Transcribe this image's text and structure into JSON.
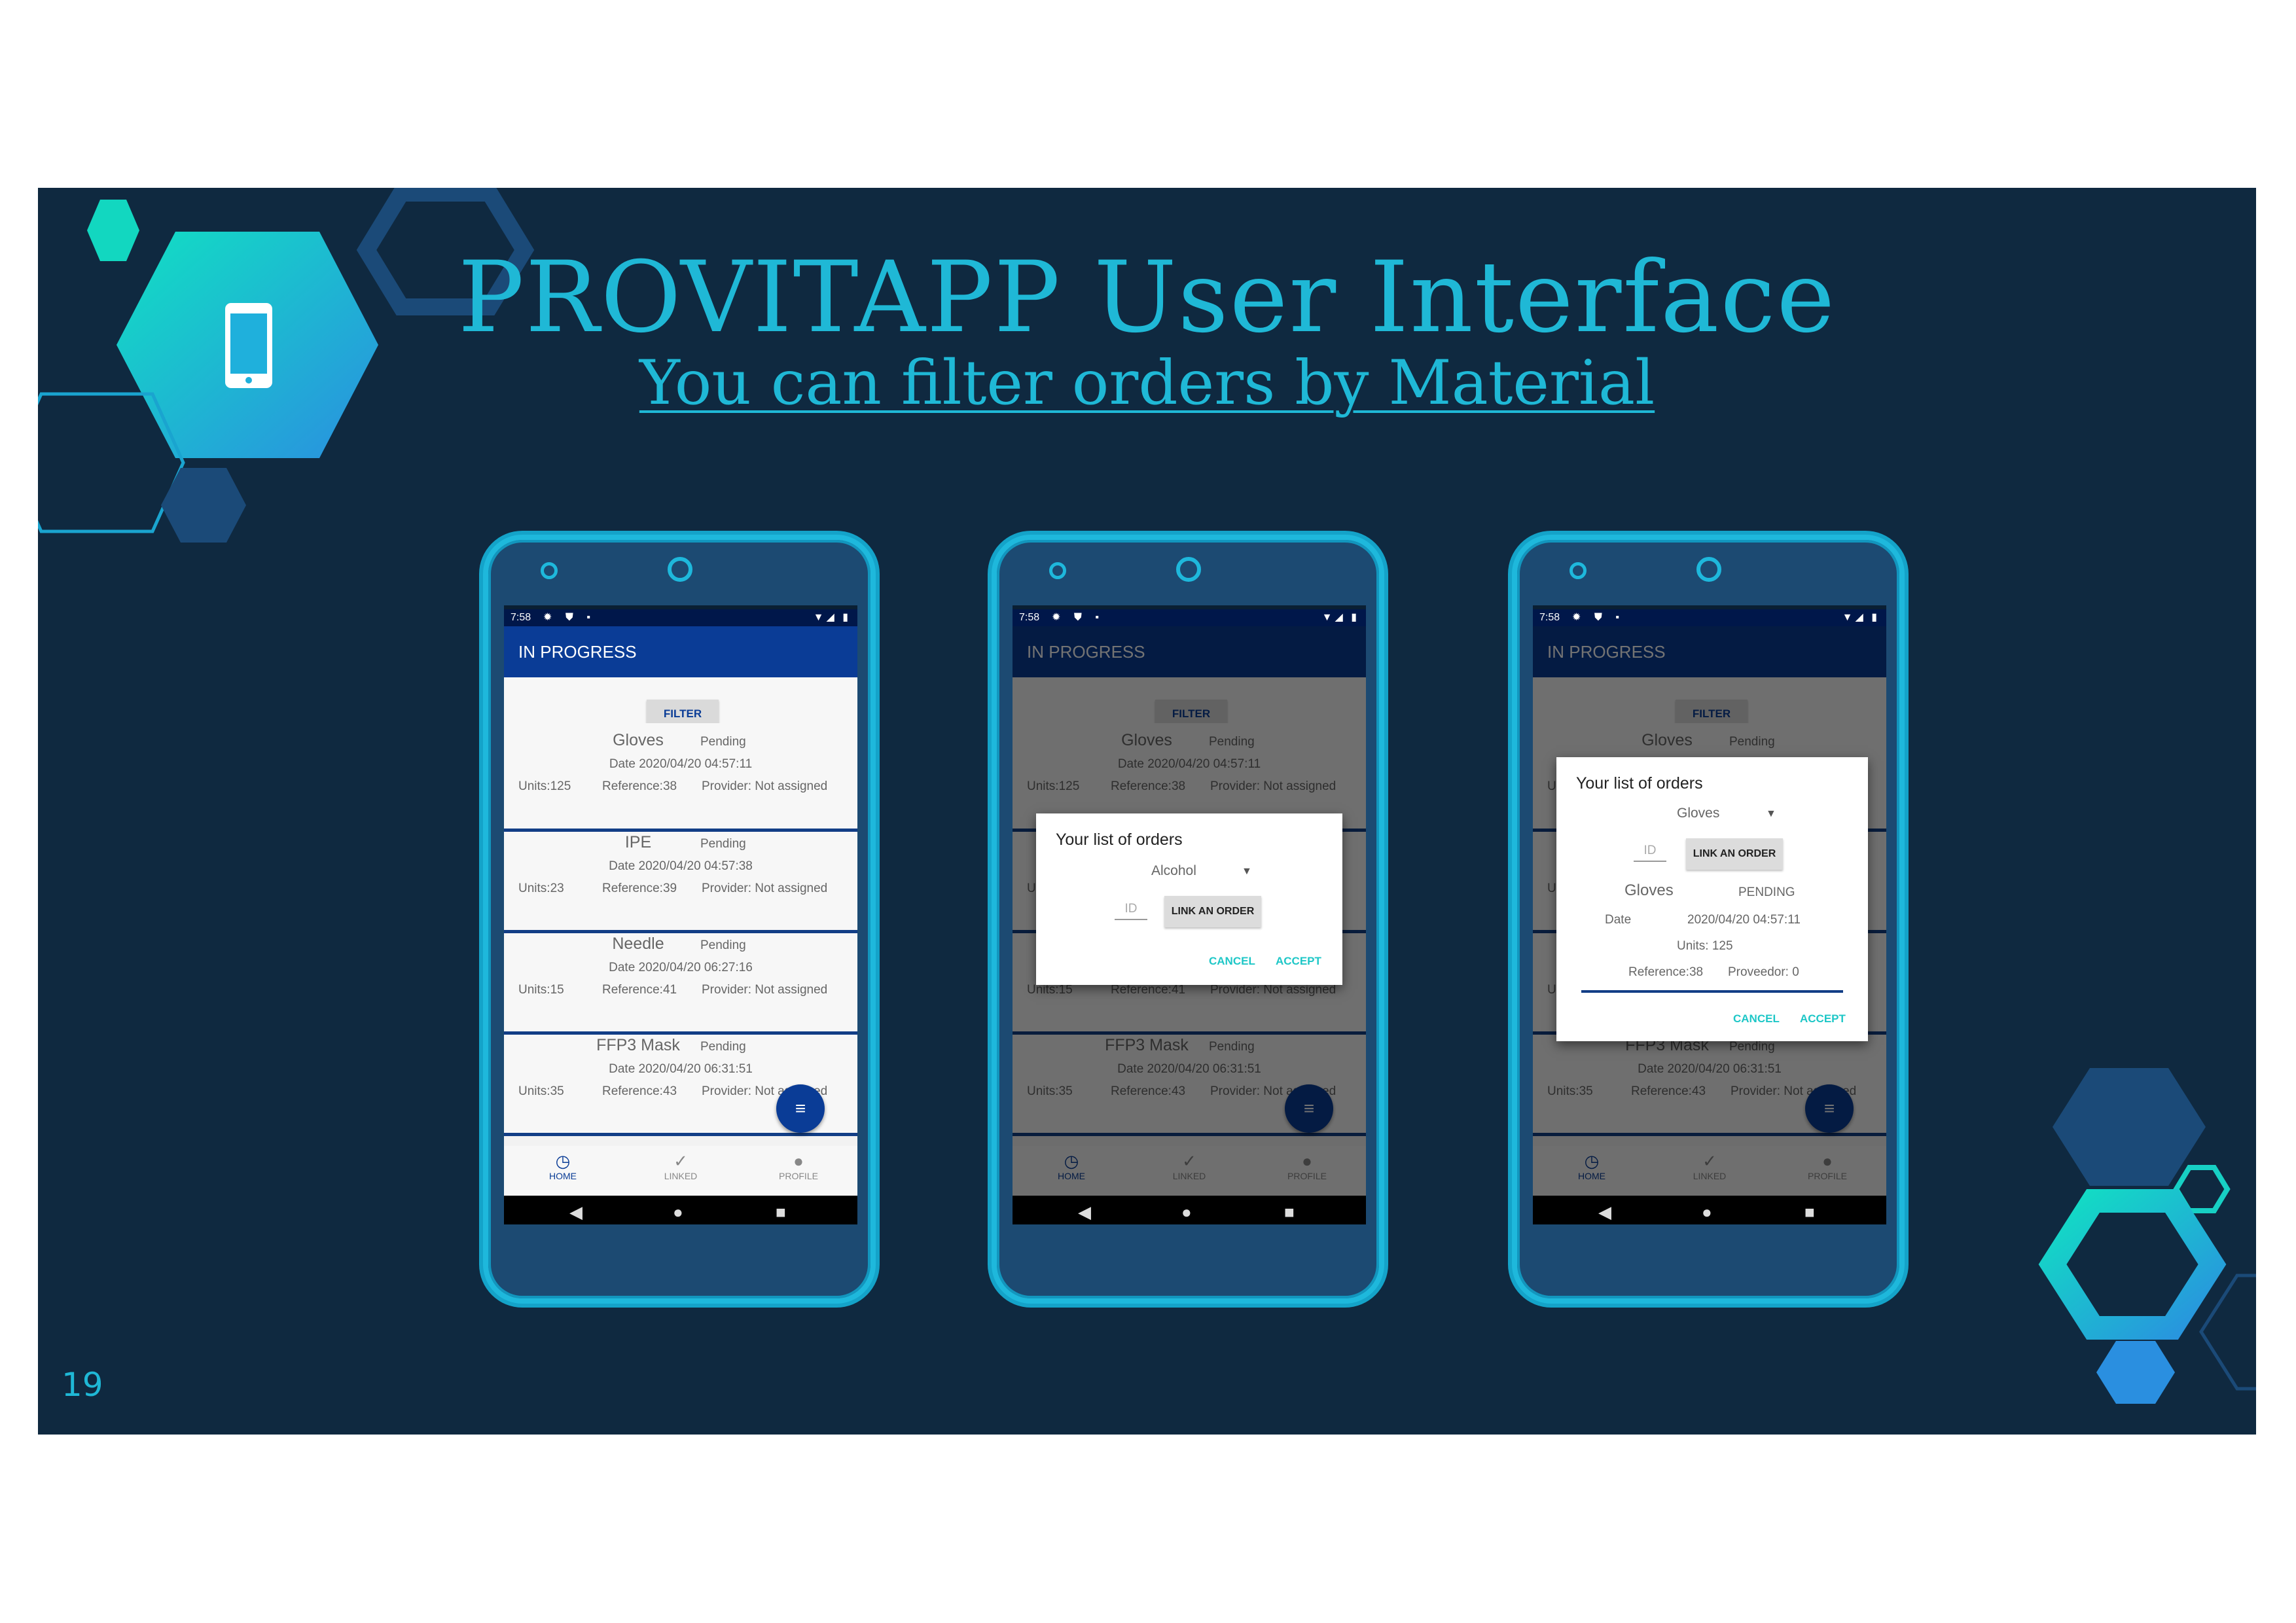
{
  "slide": {
    "title": "PROVITAPP User Interface",
    "subtitle": "You can filter orders by Material",
    "page_number": "19"
  },
  "colors": {
    "background": "#0f2940",
    "accent": "#1fb8d6",
    "app_bar": "#0a3c96",
    "teal": "#1ec7c7"
  },
  "phones": [
    {
      "status_time": "7:58",
      "app_title": "IN PROGRESS",
      "filter_label": "FILTER",
      "orders": [
        {
          "name": "Gloves",
          "status": "Pending",
          "date": "Date  2020/04/20 04:57:11",
          "units": "Units:125",
          "reference": "Reference:38",
          "provider": "Provider:  Not assigned"
        },
        {
          "name": "IPE",
          "status": "Pending",
          "date": "Date  2020/04/20 04:57:38",
          "units": "Units:23",
          "reference": "Reference:39",
          "provider": "Provider:  Not assigned"
        },
        {
          "name": "Needle",
          "status": "Pending",
          "date": "Date  2020/04/20 06:27:16",
          "units": "Units:15",
          "reference": "Reference:41",
          "provider": "Provider:  Not assigned"
        },
        {
          "name": "FFP3 Mask",
          "status": "Pending",
          "date": "Date  2020/04/20 06:31:51",
          "units": "Units:35",
          "reference": "Reference:43",
          "provider": "Provider:  Not assigned"
        }
      ],
      "nav": {
        "home": "HOME",
        "linked": "LINKED",
        "profile": "PROFILE"
      },
      "icons": {
        "fab": "filter-list-icon",
        "home": "clock-icon",
        "linked": "check-icon",
        "profile": "person-icon"
      }
    },
    {
      "dialog": {
        "title": "Your list of orders",
        "selected_material": "Alcohol",
        "id_placeholder": "ID",
        "link_button": "LINK AN ORDER",
        "cancel": "CANCEL",
        "accept": "ACCEPT"
      }
    },
    {
      "dialog": {
        "title": "Your list of orders",
        "selected_material": "Gloves",
        "id_placeholder": "ID",
        "link_button": "LINK AN ORDER",
        "order_name": "Gloves",
        "order_status": "PENDING",
        "date_label": "Date",
        "date_value": "2020/04/20 04:57:11",
        "units": "Units:  125",
        "reference": "Reference:38",
        "provider": "Proveedor:  0",
        "cancel": "CANCEL",
        "accept": "ACCEPT"
      }
    }
  ]
}
